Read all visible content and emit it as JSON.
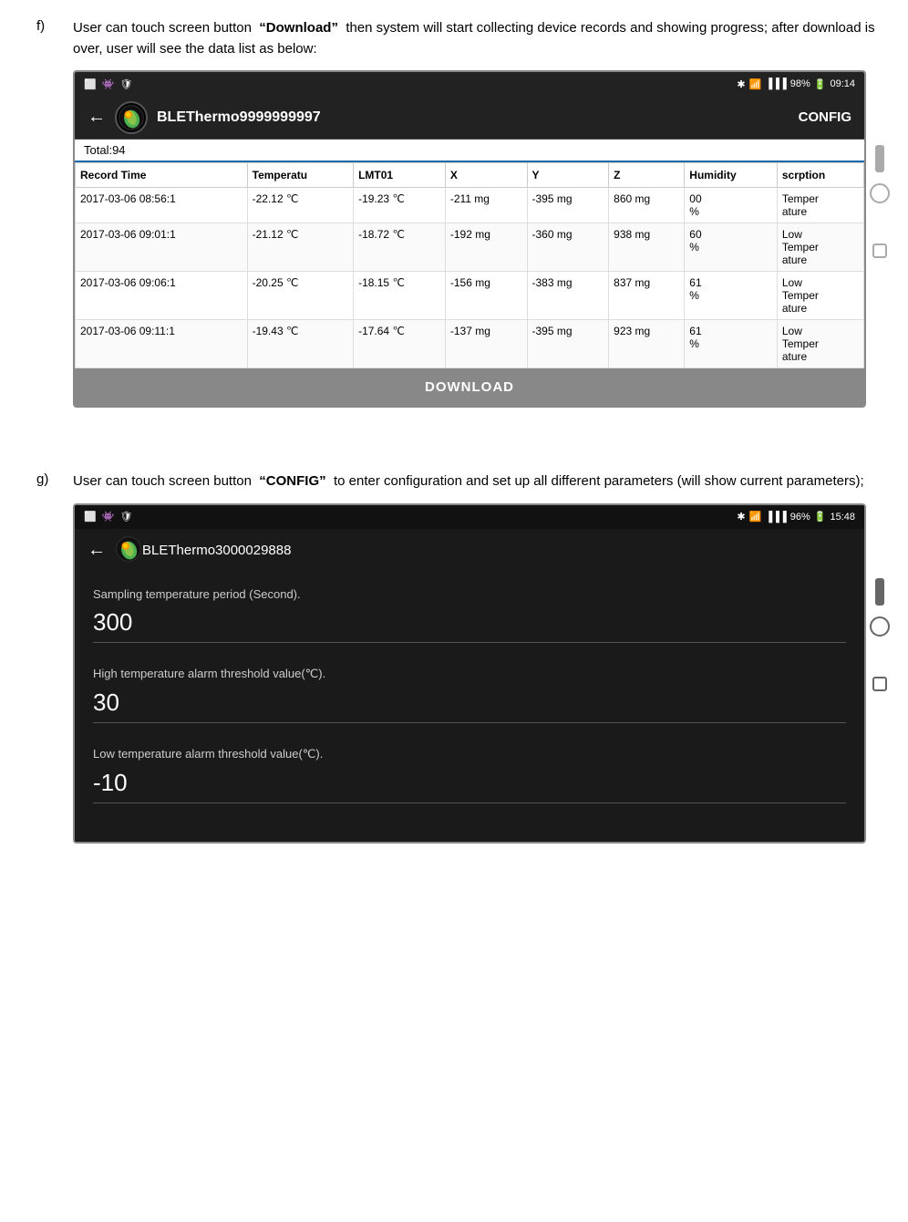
{
  "section_f": {
    "letter": "f)",
    "text_part1": "User can touch screen button",
    "button_label": "“Download”",
    "text_part2": "then system will start collecting device records and showing progress; after download is over, user will see the data list as below:",
    "phone": {
      "status_bar": {
        "left_icons": [
          "screen-icon",
          "bug-icon",
          "shield-icon"
        ],
        "right_icons": [
          "bluetooth-icon",
          "wifi-icon",
          "signal1-icon",
          "signal2-icon"
        ],
        "battery": "98%",
        "time": "09:14"
      },
      "nav": {
        "device_name": "BLEThermo9999999997",
        "config_label": "CONFIG"
      },
      "total": "Total:94",
      "table": {
        "headers": [
          "Record Time",
          "Temperatu",
          "LMT01",
          "X",
          "Y",
          "Z",
          "Humidity",
          "scrption"
        ],
        "rows": [
          [
            "2017-03-06 08:56:1",
            "-22.12 ℃",
            "-19.23 ℃",
            "-211 mg",
            "-395 mg",
            "860 mg",
            "00\n%",
            "Temper\nature"
          ],
          [
            "2017-03-06 09:01:1",
            "-21.12 ℃",
            "-18.72 ℃",
            "-192 mg",
            "-360 mg",
            "938 mg",
            "60\n%",
            "Low\nTemper\nature"
          ],
          [
            "2017-03-06 09:06:1",
            "-20.25 ℃",
            "-18.15 ℃",
            "-156 mg",
            "-383 mg",
            "837 mg",
            "61\n%",
            "Low\nTemper\nature"
          ],
          [
            "2017-03-06 09:11:1",
            "-19.43 ℃",
            "-17.64 ℃",
            "-137 mg",
            "-395 mg",
            "923 mg",
            "61\n%",
            "Low\nTemper\nature"
          ]
        ]
      },
      "download_btn": "DOWNLOAD"
    }
  },
  "section_g": {
    "letter": "g)",
    "text_part1": "User can touch screen button",
    "button_label": "“CONFIG”",
    "text_part2": "to enter configuration and set up all different parameters (will show current parameters);",
    "phone": {
      "status_bar": {
        "left_icons": [
          "screen-icon",
          "bug-icon",
          "shield-icon"
        ],
        "right_icons": [
          "bluetooth-icon",
          "wifi-icon",
          "signal1-icon",
          "signal2-icon"
        ],
        "battery": "96%",
        "time": "15:48"
      },
      "nav": {
        "device_name": "BLEThermo3000029888"
      },
      "config_fields": [
        {
          "label": "Sampling temperature period (Second).",
          "value": "300"
        },
        {
          "label": "High temperature alarm threshold value(℃).",
          "value": "30"
        },
        {
          "label": "Low temperature alarm threshold value(℃).",
          "value": "-10"
        }
      ]
    }
  }
}
